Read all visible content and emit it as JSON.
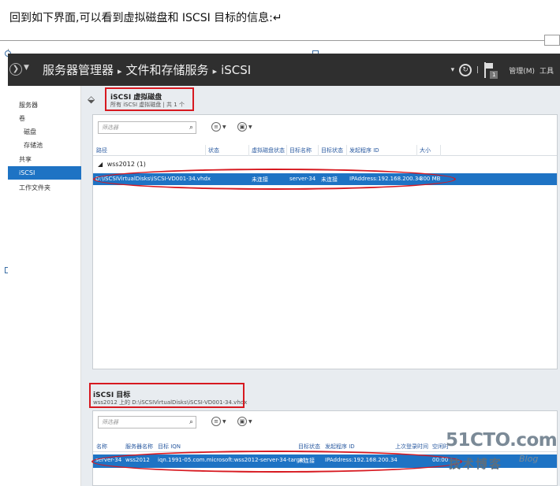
{
  "caption": "回到如下界面,可以看到虚拟磁盘和 ISCSI 目标的信息:↵",
  "titlebar": {
    "back_icon": "arrow-left-circle-icon",
    "breadcrumb": [
      "服务器管理器",
      "文件和存储服务",
      "iSCSI"
    ],
    "separator": "▸",
    "manage_label": "管理(M)",
    "tools_label": "工具",
    "flag_count": "1"
  },
  "sidebar": {
    "items": [
      {
        "label": "服务器",
        "sub": false,
        "active": false
      },
      {
        "label": "卷",
        "sub": false,
        "active": false
      },
      {
        "label": "磁盘",
        "sub": true,
        "active": false
      },
      {
        "label": "存储池",
        "sub": true,
        "active": false
      },
      {
        "label": "共享",
        "sub": false,
        "active": false
      },
      {
        "label": "iSCSI",
        "sub": false,
        "active": true
      },
      {
        "label": "工作文件夹",
        "sub": false,
        "active": false
      }
    ]
  },
  "virtual_disks": {
    "title": "iSCSI 虚拟磁盘",
    "subtitle": "所有 iSCSI 虚拟磁盘 | 共 1 个",
    "filter_placeholder": "筛选器",
    "columns": [
      "路径",
      "状态",
      "虚拟磁盘状态",
      "目标名称",
      "目标状态",
      "发起程序 ID",
      "大小"
    ],
    "group": "wss2012 (1)",
    "row": {
      "path": "D:\\iSCSIVirtualDisks\\iSCSI-VD001-34.vhdx",
      "status": "",
      "disk_status": "未连接",
      "target_name": "server-34",
      "target_status": "未连接",
      "initiator": "IPAddress:192.168.200.34",
      "size": "300 MB"
    }
  },
  "targets": {
    "title": "iSCSI 目标",
    "subtitle": "wss2012 上的 D:\\iSCSIVirtualDisks\\iSCSI-VD001-34.vhdx",
    "filter_placeholder": "筛选器",
    "columns": [
      "名称",
      "服务器名称",
      "目标 IQN",
      "目标状态",
      "发起程序 ID",
      "上次登录时间",
      "空闲时"
    ],
    "row": {
      "name": "server-34",
      "server": "wss2012",
      "iqn": "iqn.1991-05.com.microsoft:wss2012-server-34-target",
      "status": "未连接",
      "initiator": "IPAddress:192.168.200.34",
      "last_login": "",
      "idle": "00:00"
    }
  },
  "watermark": {
    "site": "51CTO.com",
    "tagline": "技术博客",
    "blog": "Blog"
  },
  "colors": {
    "titlebar": "#2f2f2f",
    "selection": "#1e73c4",
    "highlight_red": "#d71920"
  }
}
